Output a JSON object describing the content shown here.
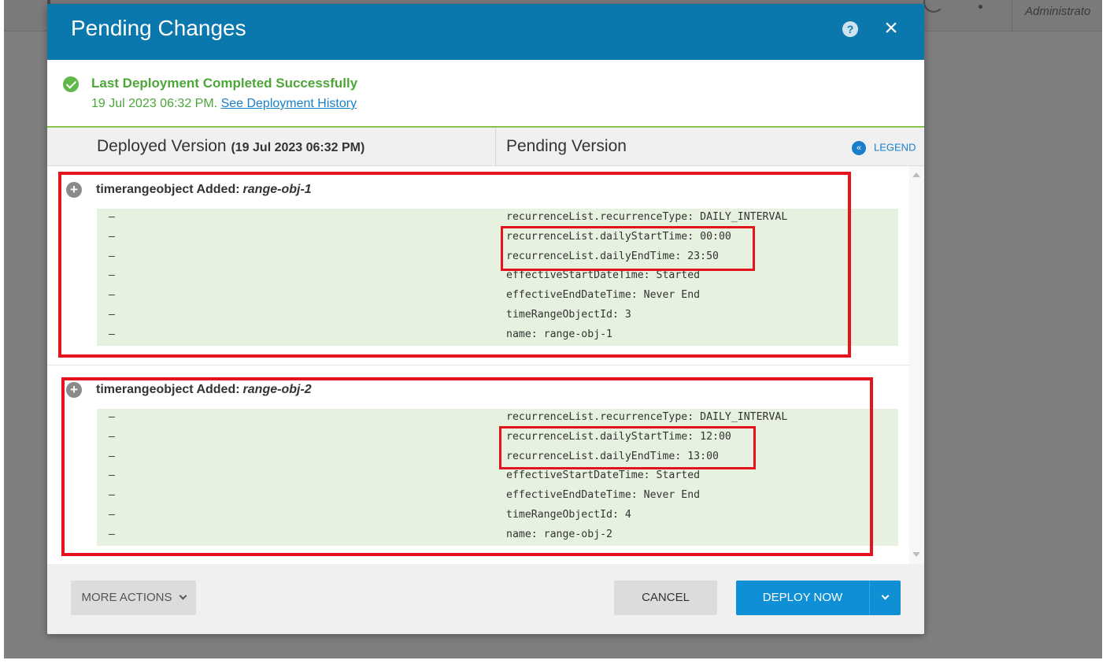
{
  "background": {
    "user_label": "Administrato"
  },
  "dialog": {
    "title": "Pending Changes",
    "help_icon": "?",
    "close_icon": "×"
  },
  "status": {
    "title": "Last Deployment Completed Successfully",
    "timestamp": "19 Jul 2023 06:32 PM.",
    "history_link": "See Deployment History"
  },
  "columns": {
    "deployed_label": "Deployed Version",
    "deployed_date": "(19 Jul 2023 06:32 PM)",
    "pending_label": "Pending Version",
    "legend_label": "LEGEND"
  },
  "sections": [
    {
      "type_label": "timerangeobject Added:",
      "object_name": "range-obj-1",
      "rows": [
        {
          "deployed": "–",
          "pending": "recurrenceList.recurrenceType: DAILY_INTERVAL"
        },
        {
          "deployed": "–",
          "pending": "recurrenceList.dailyStartTime: 00:00"
        },
        {
          "deployed": "–",
          "pending": "recurrenceList.dailyEndTime: 23:50"
        },
        {
          "deployed": "–",
          "pending": "effectiveStartDateTime: Started"
        },
        {
          "deployed": "–",
          "pending": "effectiveEndDateTime: Never End"
        },
        {
          "deployed": "–",
          "pending": "timeRangeObjectId: 3"
        },
        {
          "deployed": "–",
          "pending": "name: range-obj-1"
        }
      ]
    },
    {
      "type_label": "timerangeobject Added:",
      "object_name": "range-obj-2",
      "rows": [
        {
          "deployed": "–",
          "pending": "recurrenceList.recurrenceType: DAILY_INTERVAL"
        },
        {
          "deployed": "–",
          "pending": "recurrenceList.dailyStartTime: 12:00"
        },
        {
          "deployed": "–",
          "pending": "recurrenceList.dailyEndTime: 13:00"
        },
        {
          "deployed": "–",
          "pending": "effectiveStartDateTime: Started"
        },
        {
          "deployed": "–",
          "pending": "effectiveEndDateTime: Never End"
        },
        {
          "deployed": "–",
          "pending": "timeRangeObjectId: 4"
        },
        {
          "deployed": "–",
          "pending": "name: range-obj-2"
        }
      ]
    }
  ],
  "footer": {
    "more_actions": "MORE ACTIONS",
    "cancel": "CANCEL",
    "deploy_now": "DEPLOY NOW"
  },
  "colors": {
    "header_blue": "#0a77ad",
    "success_green": "#4ca63a",
    "diff_added_bg": "#e6f2df",
    "highlight_red": "#e3141c",
    "primary_button": "#0f8fd6"
  }
}
